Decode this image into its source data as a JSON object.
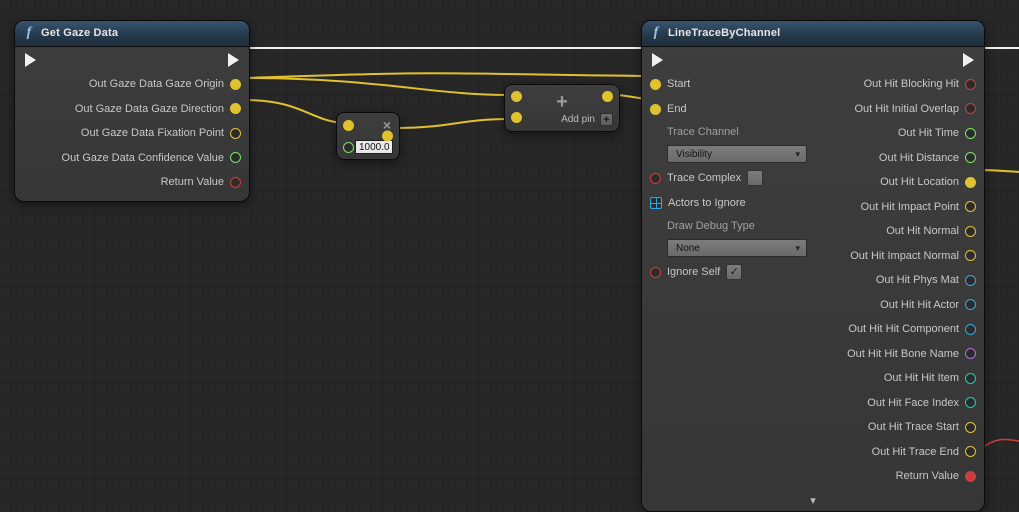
{
  "gaze_node": {
    "title": "Get Gaze Data",
    "outputs": [
      {
        "label": "Out Gaze Data Gaze Origin",
        "ptype": "vec",
        "filled": true
      },
      {
        "label": "Out Gaze Data Gaze Direction",
        "ptype": "vec",
        "filled": true
      },
      {
        "label": "Out Gaze Data Fixation Point",
        "ptype": "vec",
        "filled": false
      },
      {
        "label": "Out Gaze Data Confidence Value",
        "ptype": "float",
        "filled": false
      },
      {
        "label": "Return Value",
        "ptype": "bool",
        "filled": false
      }
    ]
  },
  "multiply_node": {
    "value": "1000.0"
  },
  "add_node": {
    "add_pin_label": "Add pin"
  },
  "trace_node": {
    "title": "LineTraceByChannel",
    "inputs": {
      "start": "Start",
      "end": "End",
      "trace_channel": "Trace Channel",
      "channel_value": "Visibility",
      "trace_complex": "Trace Complex",
      "trace_complex_on": false,
      "actors": "Actors to Ignore",
      "draw_debug": "Draw Debug Type",
      "draw_value": "None",
      "ignore_self": "Ignore Self",
      "ignore_self_on": true
    },
    "outputs": [
      {
        "label": "Out Hit Blocking Hit",
        "ptype": "bool"
      },
      {
        "label": "Out Hit Initial Overlap",
        "ptype": "bool"
      },
      {
        "label": "Out Hit Time",
        "ptype": "float"
      },
      {
        "label": "Out Hit Distance",
        "ptype": "float"
      },
      {
        "label": "Out Hit Location",
        "ptype": "vec",
        "filled": true
      },
      {
        "label": "Out Hit Impact Point",
        "ptype": "vec"
      },
      {
        "label": "Out Hit Normal",
        "ptype": "vec"
      },
      {
        "label": "Out Hit Impact Normal",
        "ptype": "vec"
      },
      {
        "label": "Out Hit Phys Mat",
        "ptype": "obj"
      },
      {
        "label": "Out Hit Hit Actor",
        "ptype": "obj"
      },
      {
        "label": "Out Hit Hit Component",
        "ptype": "obj"
      },
      {
        "label": "Out Hit Hit Bone Name",
        "ptype": "name"
      },
      {
        "label": "Out Hit Hit Item",
        "ptype": "int"
      },
      {
        "label": "Out Hit Face Index",
        "ptype": "int"
      },
      {
        "label": "Out Hit Trace Start",
        "ptype": "vec"
      },
      {
        "label": "Out Hit Trace End",
        "ptype": "vec"
      },
      {
        "label": "Return Value",
        "ptype": "bool",
        "filled": true
      }
    ]
  }
}
